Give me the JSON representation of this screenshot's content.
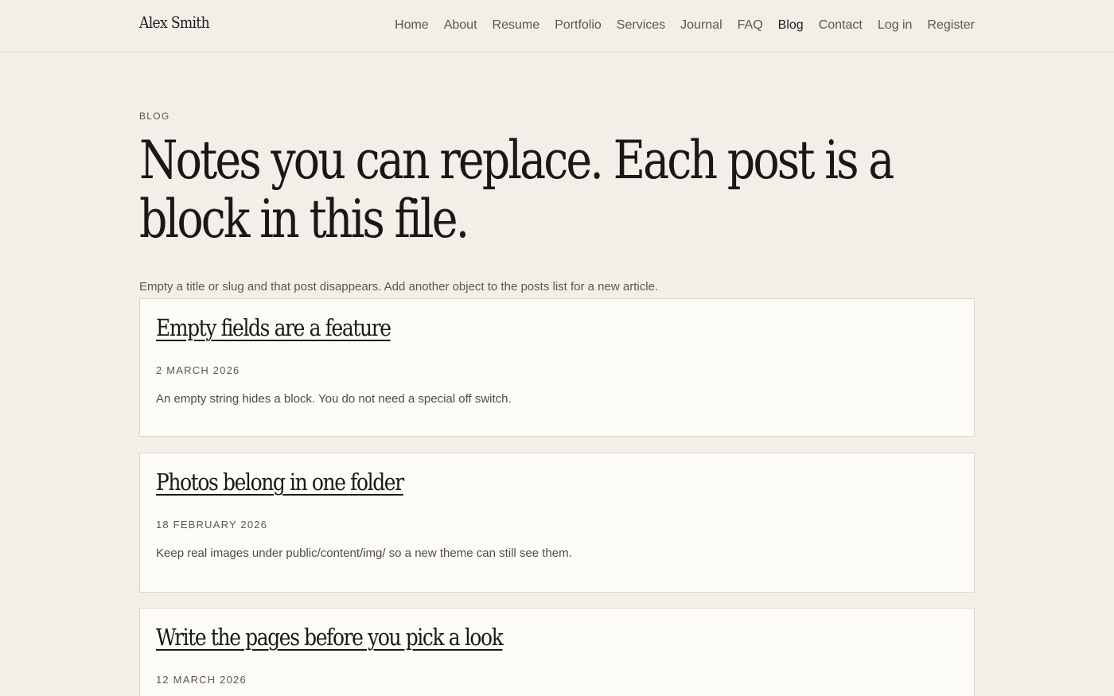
{
  "header": {
    "brand": "Alex Smith",
    "nav": [
      {
        "label": "Home"
      },
      {
        "label": "About"
      },
      {
        "label": "Resume"
      },
      {
        "label": "Portfolio"
      },
      {
        "label": "Services"
      },
      {
        "label": "Journal"
      },
      {
        "label": "FAQ"
      },
      {
        "label": "Blog",
        "active": true
      },
      {
        "label": "Contact"
      },
      {
        "label": "Log in"
      },
      {
        "label": "Register"
      }
    ]
  },
  "page": {
    "eyebrow": "BLOG",
    "title": "Notes you can replace. Each post is a block in this file.",
    "intro": "Empty a title or slug and that post disappears. Add another object to the posts list for a new article."
  },
  "posts": [
    {
      "title": "Empty fields are a feature",
      "date": "2 MARCH 2026",
      "excerpt": "An empty string hides a block. You do not need a special off switch."
    },
    {
      "title": "Photos belong in one folder",
      "date": "18 FEBRUARY 2026",
      "excerpt": "Keep real images under public/content/img/ so a new theme can still see them."
    },
    {
      "title": "Write the pages before you pick a look",
      "date": "12 MARCH 2026",
      "excerpt": ""
    }
  ],
  "colors": {
    "background": "#f3efe8",
    "card": "#fdfcf7",
    "border": "#dcd6cc",
    "text": "#1f1d1a",
    "muted": "#5b5650"
  }
}
